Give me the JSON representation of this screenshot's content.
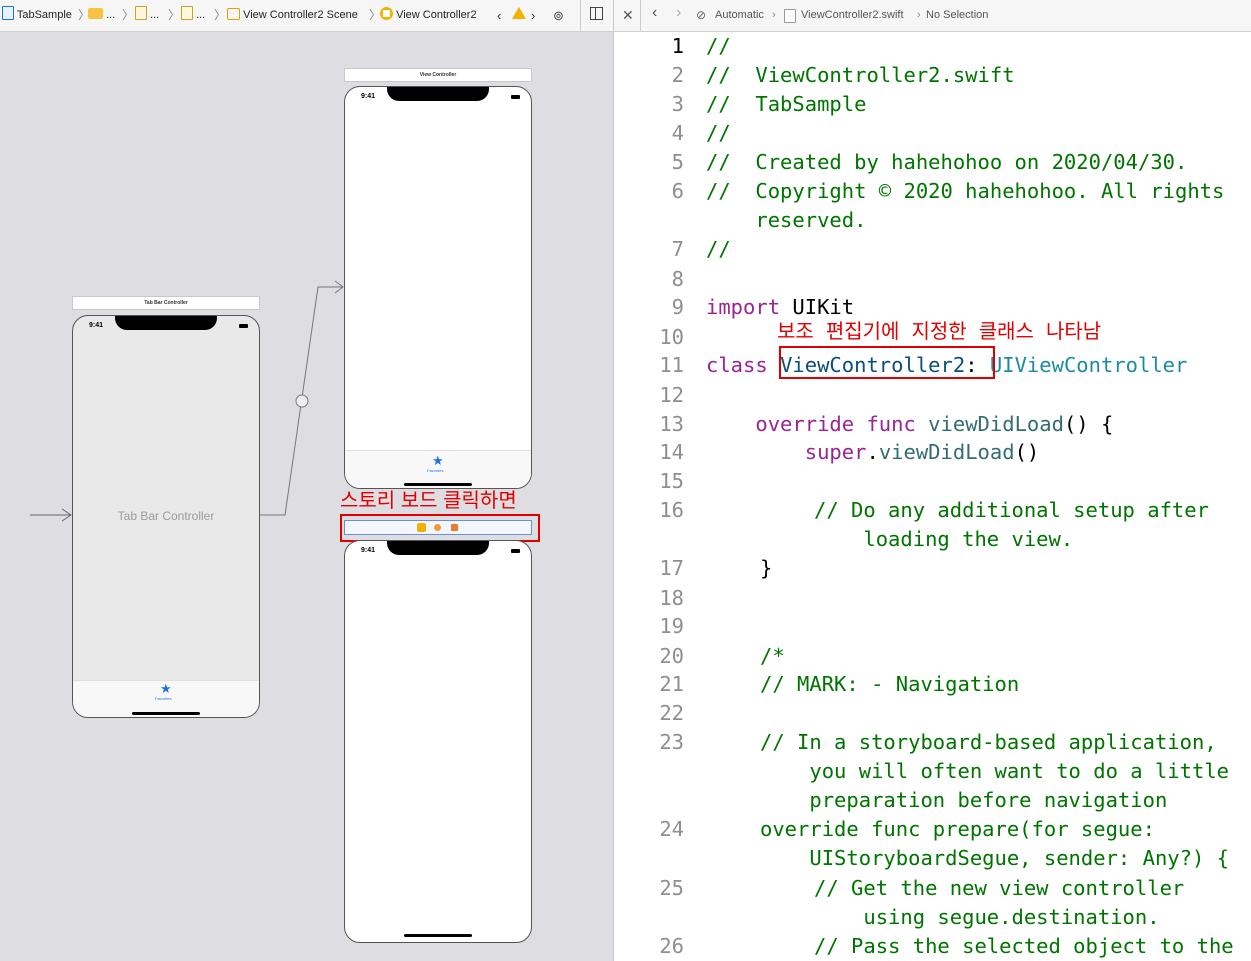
{
  "left_bar": {
    "project": "TabSample",
    "ellipsis1": "...",
    "ellipsis2": "...",
    "ellipsis3": "...",
    "scene": "View Controller2 Scene",
    "controller": "View Controller2"
  },
  "storyboard": {
    "tab_scene_title": "Tab Bar Controller",
    "tab_time": "9:41",
    "tab_center_label": "Tab Bar Controller",
    "tab_item_label": "Favorites",
    "vc_scene_title": "View Controller",
    "vc_time": "9:41",
    "vc_item_label": "Favorites",
    "vc2_time": "9:41"
  },
  "annotations": {
    "storyboard_click": "스토리 보드 클릭하면",
    "class_shown": "보조 편집기에 지정한 클래스 나타남"
  },
  "right_bar": {
    "automatic": "Automatic",
    "file": "ViewController2.swift",
    "selection": "No Selection"
  },
  "colors": {
    "annotation_red": "#e00000",
    "comment_green": "#007400",
    "keyword_purple": "#9b2393",
    "accent_blue": "#1a73e8"
  },
  "code": {
    "l1": "//",
    "l2": "//  ViewController2.swift",
    "l3": "//  TabSample",
    "l4": "//",
    "l5": "//  Created by hahehohoo on 2020/04/30.",
    "l6a": "//  Copyright © 2020 hahehohoo. All rights",
    "l6b": "    reserved.",
    "l7": "//",
    "l9_kw": "import",
    "l9_rest": " UIKit",
    "l11_kw": "class",
    "l11_name": "ViewController2",
    "l11_colon": ":",
    "l11_super": " UIViewController",
    "l13_kw": "override func",
    "l13_fn": "viewDidLoad",
    "l13_rest": "() {",
    "l14_kw": "super",
    "l14_dot": ".",
    "l14_fn": "viewDidLoad",
    "l14_rest": "()",
    "l16a": "// Do any additional setup after",
    "l16b": "    loading the view.",
    "l17": "}",
    "l20": "/*",
    "l21": "// MARK: - Navigation",
    "l23a": "// In a storyboard-based application,",
    "l23b": "    you will often want to do a little",
    "l23c": "    preparation before navigation",
    "l24a": "override func prepare(for segue:",
    "l24b": "    UIStoryboardSegue, sender: Any?) {",
    "l25a": "// Get the new view controller",
    "l25b": "    using segue.destination.",
    "l26": "// Pass the selected object to the"
  },
  "line_numbers": [
    "1",
    "2",
    "3",
    "4",
    "5",
    "6",
    "7",
    "8",
    "9",
    "10",
    "11",
    "12",
    "13",
    "14",
    "15",
    "16",
    "17",
    "18",
    "19",
    "20",
    "21",
    "22",
    "23",
    "24",
    "25",
    "26"
  ]
}
